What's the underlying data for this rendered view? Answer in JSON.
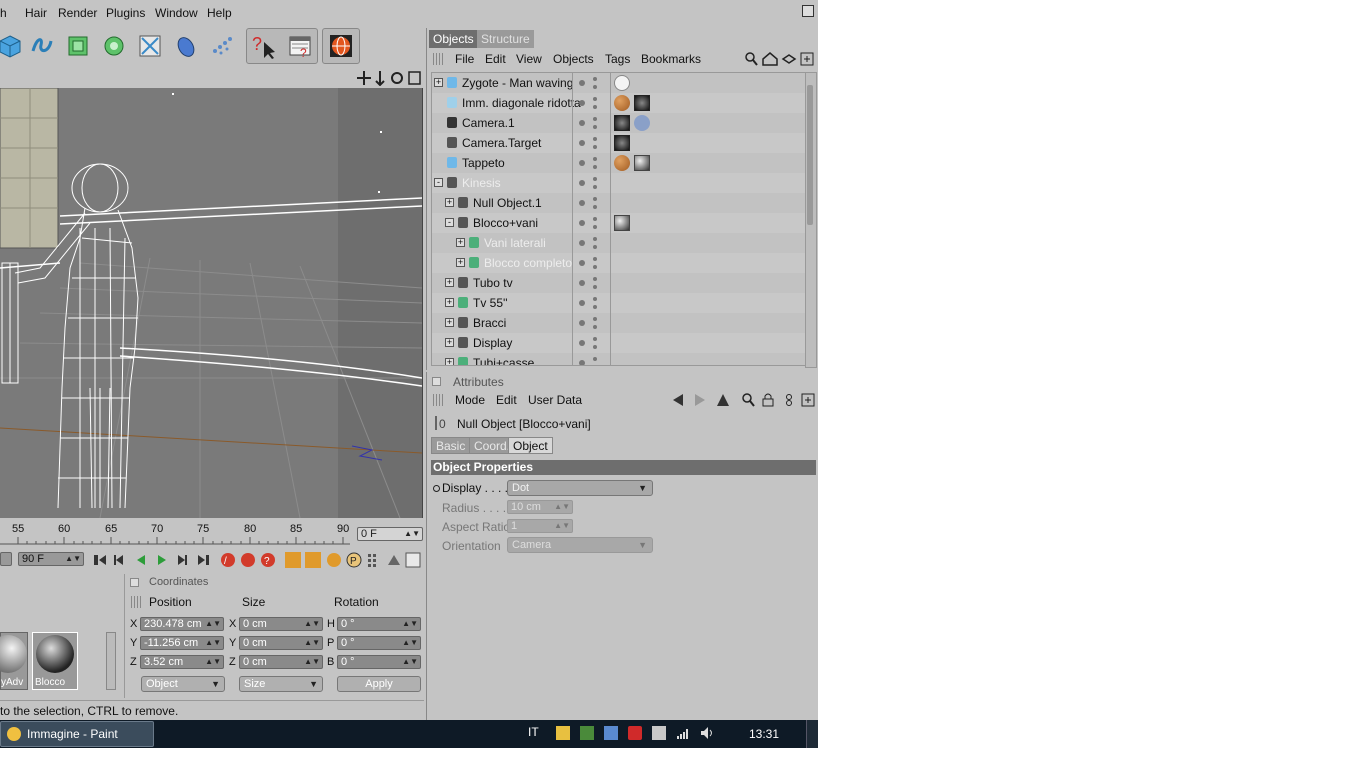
{
  "menubar": {
    "items": [
      "h",
      "Hair",
      "Render",
      "Plugins",
      "Window",
      "Help"
    ]
  },
  "viewport": {
    "label": "3D viewport"
  },
  "timeline": {
    "ticks": [
      "55",
      "60",
      "65",
      "70",
      "75",
      "80",
      "85",
      "90"
    ],
    "current_frame": "0 F",
    "end_frame": "90 F"
  },
  "materials": {
    "items": [
      "yAdv",
      "Blocco"
    ]
  },
  "coordinates": {
    "title": "Coordinates",
    "col_position": "Position",
    "col_size": "Size",
    "col_rotation": "Rotation",
    "pos_labels": [
      "X",
      "Y",
      "Z"
    ],
    "pos_values": [
      "230.478 cm",
      "-11.256 cm",
      "3.52 cm"
    ],
    "size_labels": [
      "X",
      "Y",
      "Z"
    ],
    "size_values": [
      "0 cm",
      "0 cm",
      "0 cm"
    ],
    "rot_labels": [
      "H",
      "P",
      "B"
    ],
    "rot_values": [
      "0 °",
      "0 °",
      "0 °"
    ],
    "mode_select": "Object",
    "size_select": "Size",
    "apply_label": "Apply"
  },
  "status": {
    "text": "to the selection, CTRL to remove."
  },
  "objects_panel": {
    "tabs": [
      "Objects",
      "Structure"
    ],
    "menu": [
      "File",
      "Edit",
      "View",
      "Objects",
      "Tags",
      "Bookmarks"
    ],
    "rows": [
      {
        "name": "Zygote - Man waving",
        "level": 0,
        "exp": "+",
        "dim": false,
        "icon": "#6fb8e8",
        "tags": [
          "white"
        ]
      },
      {
        "name": "Imm. diagonale ridotta",
        "level": 0,
        "exp": "",
        "dim": false,
        "icon": "#9fd0ea",
        "tags": [
          "balls",
          "dark"
        ]
      },
      {
        "name": "Camera.1",
        "level": 0,
        "exp": "",
        "dim": false,
        "icon": "#333",
        "tags": [
          "dark",
          "target"
        ]
      },
      {
        "name": "Camera.Target",
        "level": 0,
        "exp": "",
        "dim": false,
        "icon": "#555",
        "tags": [
          "dark"
        ]
      },
      {
        "name": "Tappeto",
        "level": 0,
        "exp": "",
        "dim": false,
        "icon": "#6fb8e8",
        "tags": [
          "balls",
          "sphere"
        ]
      },
      {
        "name": "Kinesis",
        "level": 0,
        "exp": "-",
        "dim": true,
        "icon": "#555",
        "tags": []
      },
      {
        "name": "Null Object.1",
        "level": 1,
        "exp": "+",
        "dim": false,
        "icon": "#555",
        "tags": []
      },
      {
        "name": "Blocco+vani",
        "level": 1,
        "exp": "-",
        "dim": false,
        "icon": "#555",
        "tags": [
          "sphere"
        ]
      },
      {
        "name": "Vani laterali",
        "level": 2,
        "exp": "+",
        "dim": true,
        "icon": "#4caf7a",
        "tags": []
      },
      {
        "name": "Blocco completo",
        "level": 2,
        "exp": "+",
        "dim": true,
        "icon": "#4caf7a",
        "tags": []
      },
      {
        "name": "Tubo tv",
        "level": 1,
        "exp": "+",
        "dim": false,
        "icon": "#555",
        "tags": []
      },
      {
        "name": "Tv 55''",
        "level": 1,
        "exp": "+",
        "dim": false,
        "icon": "#4caf7a",
        "tags": []
      },
      {
        "name": "Bracci",
        "level": 1,
        "exp": "+",
        "dim": false,
        "icon": "#555",
        "tags": []
      },
      {
        "name": "Display",
        "level": 1,
        "exp": "+",
        "dim": false,
        "icon": "#555",
        "tags": []
      },
      {
        "name": "Tubi+casse",
        "level": 1,
        "exp": "+",
        "dim": false,
        "icon": "#4caf7a",
        "tags": []
      }
    ]
  },
  "attributes": {
    "title": "Attributes",
    "menu": [
      "Mode",
      "Edit",
      "User Data"
    ],
    "object_title": "Null Object [Blocco+vani]",
    "tabs": [
      "Basic",
      "Coord.",
      "Object"
    ],
    "section": "Object Properties",
    "props": [
      {
        "label": "Display . . . .",
        "value": "Dot",
        "kind": "dropdown",
        "enabled": true
      },
      {
        "label": "Radius . . . .",
        "value": "10 cm",
        "kind": "spinner",
        "enabled": false
      },
      {
        "label": "Aspect Ratio",
        "value": "1",
        "kind": "spinner",
        "enabled": false
      },
      {
        "label": "Orientation",
        "value": "Camera",
        "kind": "dropdown",
        "enabled": false
      }
    ]
  },
  "taskbar": {
    "app_label": "Immagine - Paint",
    "lang": "IT",
    "clock": "13:31"
  },
  "colors": {
    "panel": "#c4c4c4",
    "viewport": "#7a7a7a",
    "taskbar": "#0e1a26",
    "section_header": "#6e6e6e"
  }
}
